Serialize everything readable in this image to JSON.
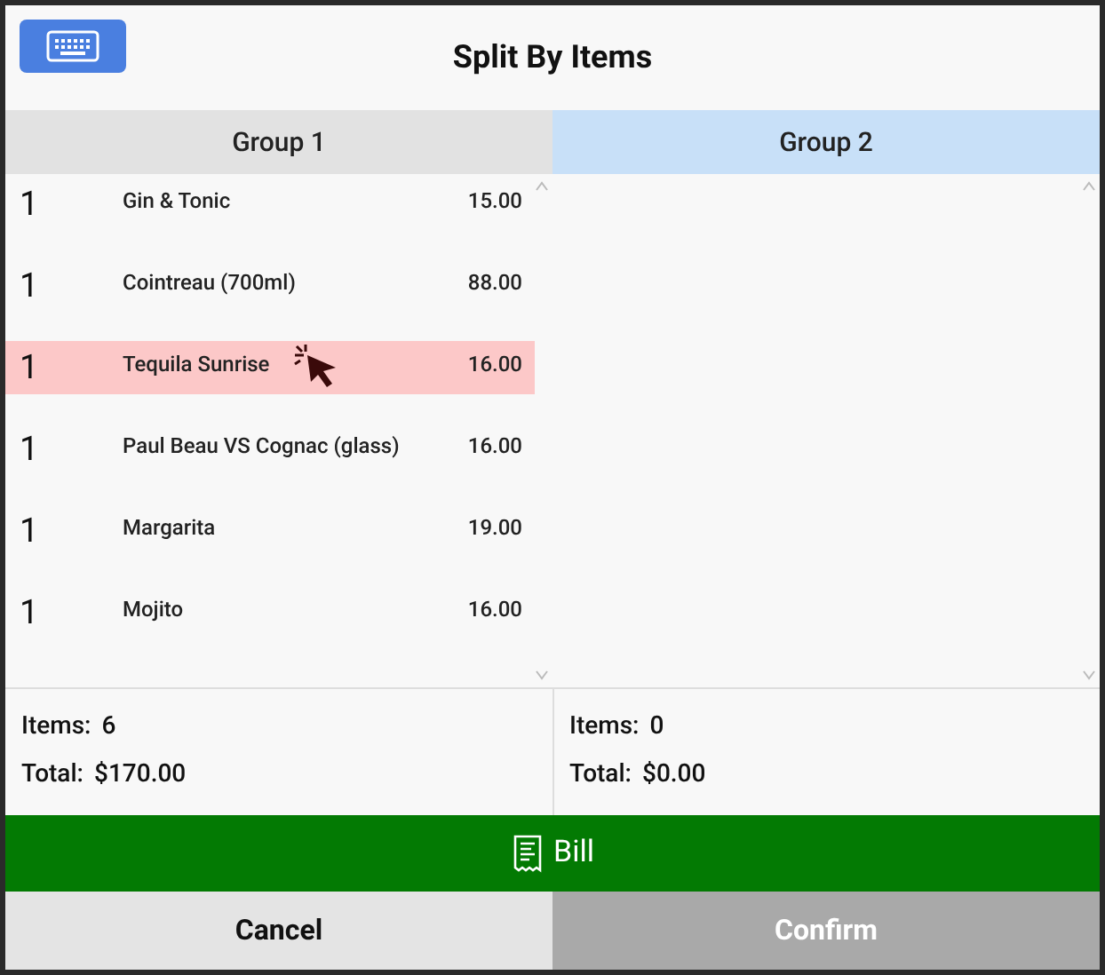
{
  "title": "Split By Items",
  "groups": [
    {
      "label": "Group 1",
      "selected": false,
      "items": [
        {
          "qty": "1",
          "name": "Gin & Tonic",
          "price": "15.00",
          "selected": false
        },
        {
          "qty": "1",
          "name": "Cointreau (700ml)",
          "price": "88.00",
          "selected": false
        },
        {
          "qty": "1",
          "name": "Tequila Sunrise",
          "price": "16.00",
          "selected": true
        },
        {
          "qty": "1",
          "name": "Paul Beau VS Cognac (glass)",
          "price": "16.00",
          "selected": false
        },
        {
          "qty": "1",
          "name": "Margarita",
          "price": "19.00",
          "selected": false
        },
        {
          "qty": "1",
          "name": "Mojito",
          "price": "16.00",
          "selected": false
        }
      ],
      "items_label": "Items:",
      "items_count": "6",
      "total_label": "Total:",
      "total": "$170.00"
    },
    {
      "label": "Group 2",
      "selected": true,
      "items_label": "Items:",
      "items_count": "0",
      "total_label": "Total:",
      "total": "$0.00"
    }
  ],
  "bill_button": "Bill",
  "buttons": [
    {
      "label": "Cancel",
      "disabled": false
    },
    {
      "label": "Confirm",
      "disabled": true
    }
  ]
}
